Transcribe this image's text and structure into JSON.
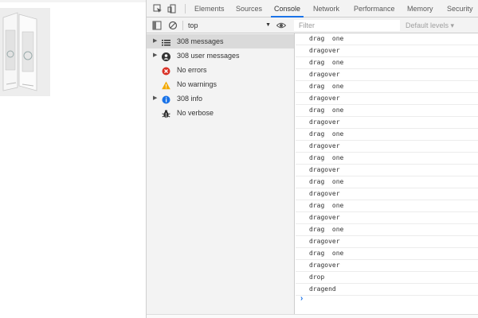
{
  "devtools": {
    "tabs": [
      "Elements",
      "Sources",
      "Console",
      "Network",
      "Performance",
      "Memory",
      "Security"
    ],
    "active_tab": "Console"
  },
  "toolbar": {
    "context": "top",
    "filter_placeholder": "Filter",
    "levels_label": "Default levels ▾"
  },
  "sidebar": {
    "items": [
      {
        "label": "308 messages",
        "icon": "list-icon",
        "expandable": true,
        "selected": true
      },
      {
        "label": "308 user messages",
        "icon": "user-icon",
        "expandable": true,
        "selected": false
      },
      {
        "label": "No errors",
        "icon": "error-icon",
        "expandable": false,
        "selected": false
      },
      {
        "label": "No warnings",
        "icon": "warning-icon",
        "expandable": false,
        "selected": false
      },
      {
        "label": "308 info",
        "icon": "info-icon",
        "expandable": true,
        "selected": false
      },
      {
        "label": "No verbose",
        "icon": "bug-icon",
        "expandable": false,
        "selected": false
      }
    ]
  },
  "console": {
    "messages": [
      "drag  one",
      "dragover",
      "drag  one",
      "dragover",
      "drag  one",
      "dragover",
      "drag  one",
      "dragover",
      "drag  one",
      "dragover",
      "drag  one",
      "dragover",
      "drag  one",
      "dragover",
      "drag  one",
      "dragover",
      "drag  one",
      "dragover",
      "drag  one",
      "dragover",
      "drop",
      "dragend"
    ],
    "prompt_symbol": "›"
  },
  "colors": {
    "accent": "#1a73e8",
    "error": "#d93025",
    "warning": "#f2a900",
    "panel_bg": "#f3f3f3"
  }
}
